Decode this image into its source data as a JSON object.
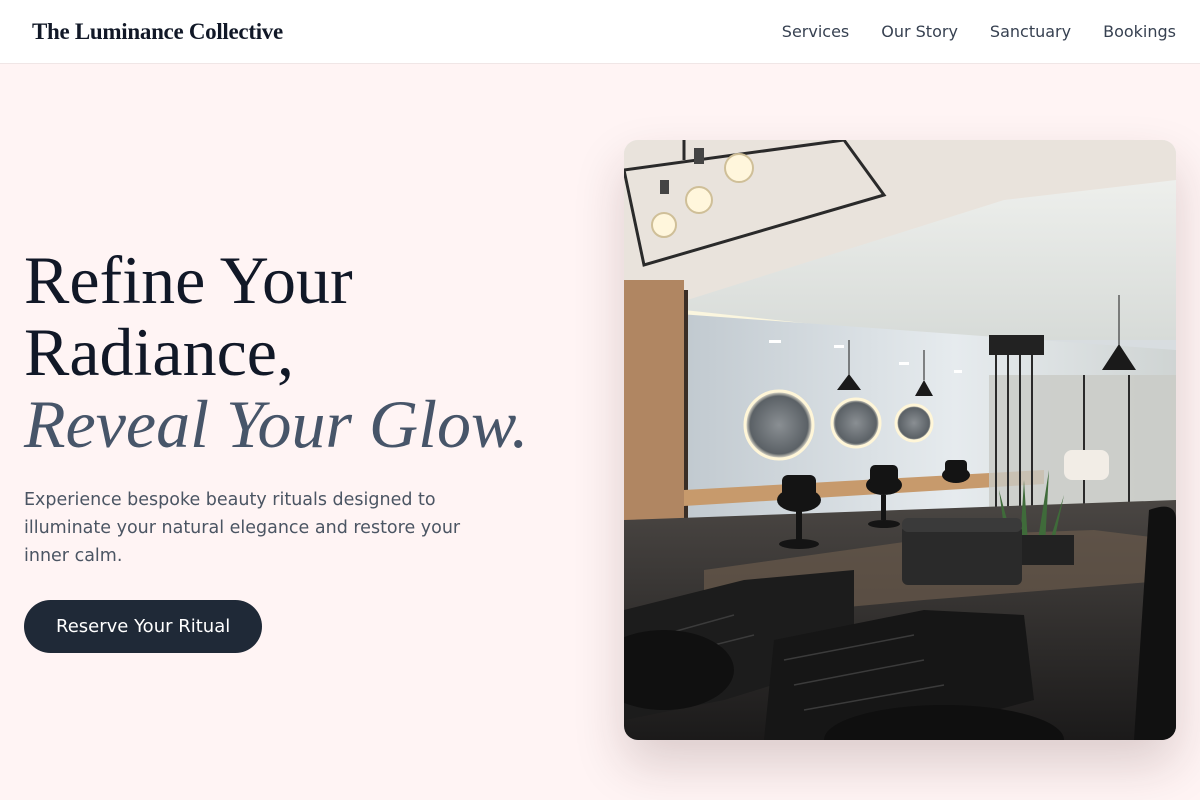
{
  "header": {
    "brand": "The Luminance Collective",
    "nav": [
      {
        "label": "Services"
      },
      {
        "label": "Our Story"
      },
      {
        "label": "Sanctuary"
      },
      {
        "label": "Bookings"
      }
    ]
  },
  "hero": {
    "headline_line1": "Refine Your",
    "headline_line2": "Radiance,",
    "headline_accent": "Reveal Your Glow.",
    "subcopy": "Experience bespoke beauty rituals designed to illuminate your natural elegance and restore your inner calm.",
    "cta_label": "Reserve Your Ritual",
    "image_alt": "Salon interior with round backlit mirrors, black styling chairs, tufted benches and pendant lights"
  },
  "colors": {
    "background": "#fff4f4",
    "text": "#111827",
    "accent_text": "#475569",
    "button": "#1f2937"
  }
}
